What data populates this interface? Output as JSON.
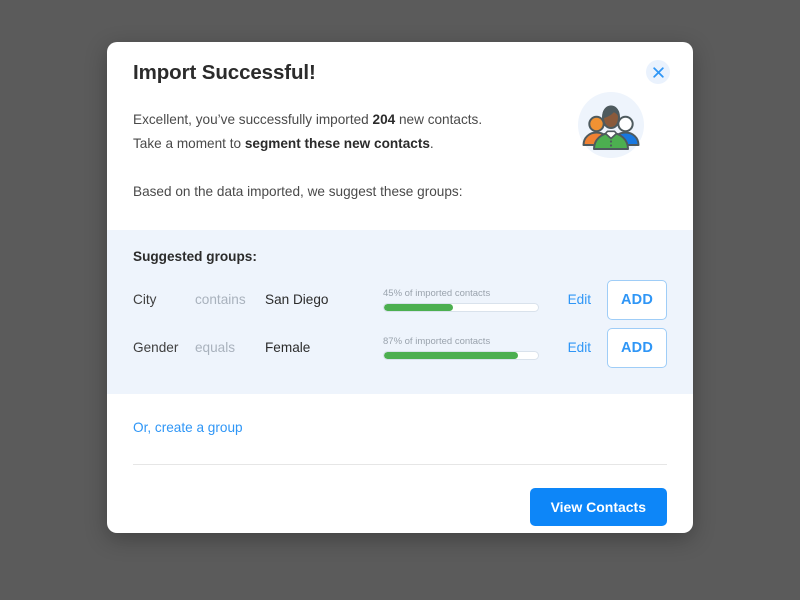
{
  "backdrop": {
    "color": "#5b5b5b"
  },
  "dialog": {
    "title": "Import Successful!",
    "close_label": "×",
    "intro": {
      "line1_prefix": "Excellent, you’ve successfully imported ",
      "line1_count": "204",
      "line1_suffix": " new contacts.",
      "line2_prefix": "Take a moment to ",
      "line2_strong": "segment these new contacts",
      "line2_suffix": ".",
      "line3": "Based on the data imported, we suggest these groups:"
    },
    "illustration_name": "group-of-people-illustration",
    "groups_section": {
      "label": "Suggested groups:",
      "rows": [
        {
          "field": "City",
          "operator": "contains",
          "value": "San Diego",
          "meter_label": "45% of imported contacts",
          "percent": 45,
          "edit_label": "Edit",
          "add_label": "ADD"
        },
        {
          "field": "Gender",
          "operator": "equals",
          "value": "Female",
          "meter_label": "87% of imported contacts",
          "percent": 87,
          "edit_label": "Edit",
          "add_label": "ADD"
        }
      ]
    },
    "footer": {
      "create_group_link": "Or, create a group",
      "primary_button": "View Contacts"
    }
  },
  "colors": {
    "accent_blue": "#2f96f6",
    "primary_button": "#0d86f8",
    "meter_green": "#4caf50",
    "band_background": "#eef4fc",
    "add_border": "#9fcdf7"
  }
}
